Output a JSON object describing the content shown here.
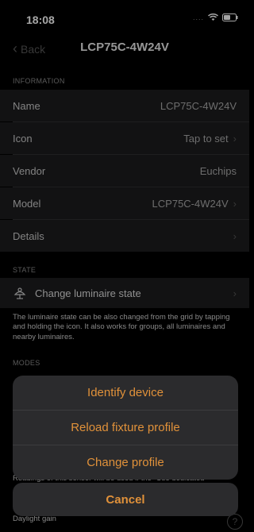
{
  "status_bar": {
    "time": "18:08"
  },
  "nav": {
    "back_label": "Back",
    "title": "LCP75C-4W24V"
  },
  "sections": {
    "information": "INFORMATION",
    "state": "STATE",
    "modes": "MODES"
  },
  "info_rows": [
    {
      "label": "Name",
      "value": "LCP75C-4W24V",
      "chevron": false
    },
    {
      "label": "Icon",
      "value": "Tap to set",
      "chevron": true
    },
    {
      "label": "Vendor",
      "value": "Euchips",
      "chevron": false
    },
    {
      "label": "Model",
      "value": "LCP75C-4W24V",
      "chevron": true
    },
    {
      "label": "Details",
      "value": "",
      "chevron": true
    }
  ],
  "state_row": {
    "label": "Change luminaire state"
  },
  "state_note": "The luminaire state can be also changed from the grid by tapping and holding the icon. It also works for groups, all luminaires and nearby luminaires.",
  "action_sheet": {
    "items": [
      "Identify device",
      "Reload fixture profile",
      "Change profile"
    ],
    "cancel": "Cancel"
  },
  "background_text": {
    "sensor_note": "Readings of this sensor will be used if the \"Use dedicated",
    "daylight_gain": "Daylight gain"
  },
  "colors": {
    "accent": "#e0913a",
    "row_bg": "#1c1c1e",
    "sheet_bg": "#2b2b2d"
  }
}
